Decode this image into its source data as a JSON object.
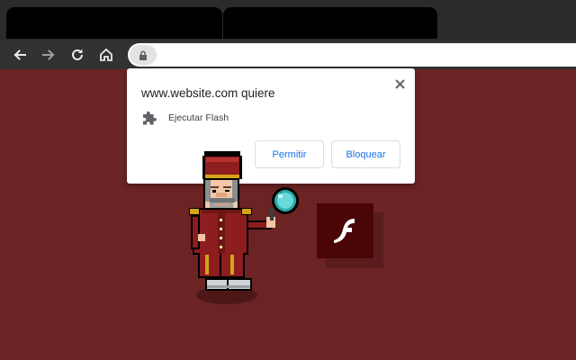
{
  "browser": {
    "tabs": [
      {
        "label": ""
      },
      {
        "label": ""
      }
    ],
    "omnibox": {
      "url": ""
    },
    "nav": {
      "back_icon": "arrow-left-icon",
      "forward_icon": "arrow-right-icon",
      "reload_icon": "reload-icon",
      "home_icon": "home-icon",
      "lock_icon": "lock-icon"
    }
  },
  "popup": {
    "title": "www.website.com quiere",
    "permission_icon": "puzzle-piece-icon",
    "permission_label": "Ejecutar Flash",
    "allow_label": "Permitir",
    "block_label": "Bloquear",
    "close_icon": "close-icon"
  },
  "page": {
    "background_color": "#6b2324",
    "character_icon": "pixel-detective-with-magnifying-glass",
    "flash_logo_icon": "flash-logo-icon",
    "flash_letter": "f"
  },
  "colors": {
    "accent": "#1a73e8",
    "flash_bg": "#4a0507"
  }
}
